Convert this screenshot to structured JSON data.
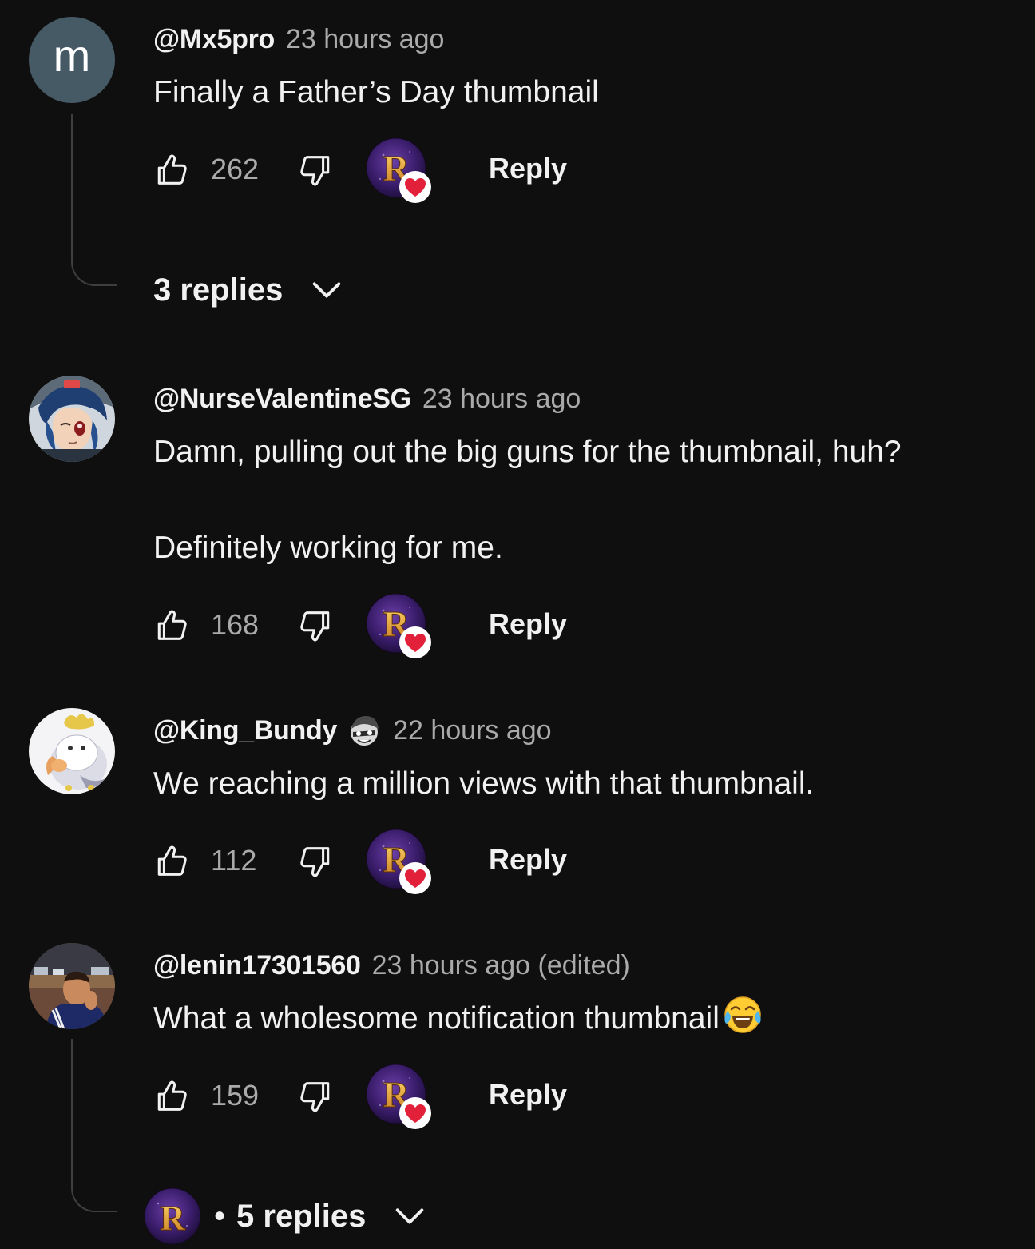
{
  "comments": [
    {
      "author": "@Mx5pro",
      "time": "23 hours ago",
      "avatar_letter": "m",
      "text_lines": [
        "Finally a Father’s Day thumbnail"
      ],
      "likes": "262",
      "reply_label": "Reply",
      "replies_label": "3 replies"
    },
    {
      "author": "@NurseValentineSG",
      "time": "23 hours ago",
      "text_lines": [
        "Damn, pulling out the big guns for the thumbnail, huh?",
        "Definitely working for me."
      ],
      "likes": "168",
      "reply_label": "Reply"
    },
    {
      "author": "@King_Bundy",
      "time": "22 hours ago",
      "text_lines": [
        "We reaching a million views with that thumbnail."
      ],
      "likes": "112",
      "reply_label": "Reply"
    },
    {
      "author": "@lenin17301560",
      "time": "23 hours ago (edited)",
      "text_lines": [
        "What a wholesome notification thumbnail"
      ],
      "likes": "159",
      "reply_label": "Reply",
      "replies_label": "5 replies",
      "replies_separator": "•"
    }
  ],
  "colors": {
    "background": "#0f0f0f",
    "primary_text": "#f1f1f1",
    "secondary_text": "#aaaaaa",
    "heart": "#e3203a",
    "creator_avatar": "#3b1f6b",
    "creator_letter": "#e7a83a"
  },
  "icons": {
    "like": "thumbs-up-outline",
    "dislike": "thumbs-down-outline",
    "creator_heart": "creator-heart",
    "expand": "chevron-down",
    "emoji": "face-with-tears-of-joy"
  }
}
